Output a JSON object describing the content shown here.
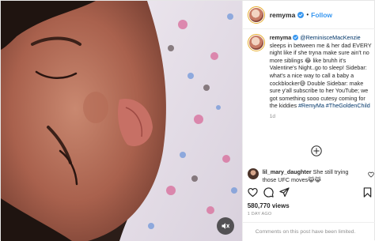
{
  "post": {
    "username": "remyma",
    "follow_label": "Follow",
    "separator": "•",
    "caption": {
      "username": "remyma",
      "mention": "@ReminisceMacKenzie",
      "text": " sleeps in between me & her dad EVERY night like if she tryna make sure ain't no more siblings 😂 like bruhh it's Valentine's Night..go to sleep! Sidebar: what's a nice way to call a baby a cockblocker😅 Double Sidebar: make sure y'all subscribe to her YouTube; we got something sooo cutesy coming for the kiddies ",
      "hashtags": "#RemyMa #TheGoldenChild",
      "time": "1d"
    },
    "comment": {
      "username": "lil_mary_daughter",
      "text": " She still trying those UFC moves😹😹"
    },
    "views": "580,770 views",
    "date": "1 DAY AGO",
    "comments_limited": "Comments on this post have been limited."
  },
  "colors": {
    "follow_blue": "#3897f0",
    "hashtag_blue": "#003569",
    "muted_gray": "#8e8e8e",
    "story_ring": "#e7ad2f"
  },
  "icons": [
    "verified-badge-icon",
    "add-comment-icon",
    "heart-icon",
    "comment-icon",
    "share-icon",
    "bookmark-icon",
    "audio-muted-icon"
  ]
}
